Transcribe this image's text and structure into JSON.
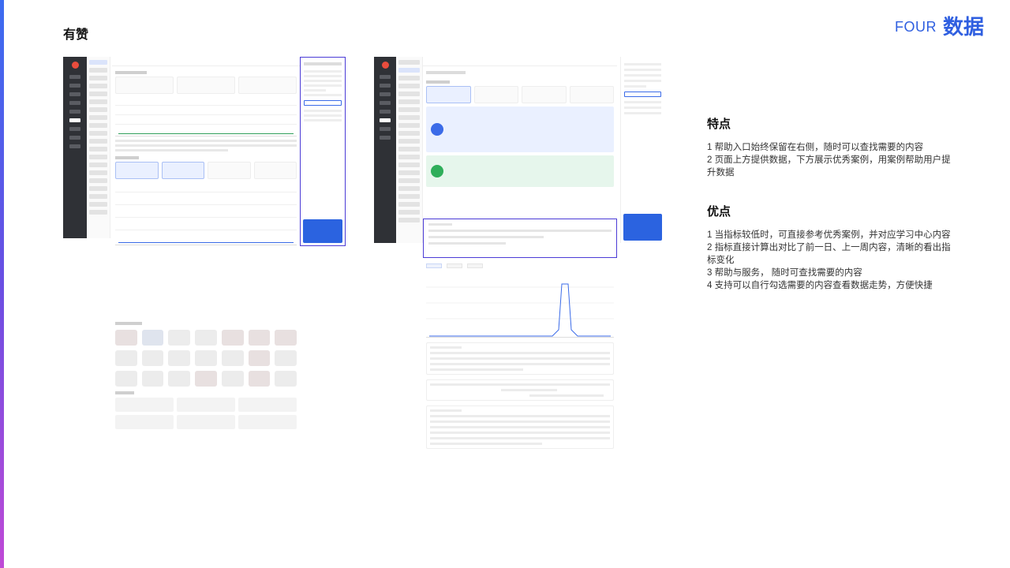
{
  "header": {
    "brand": "有赞",
    "section_no": "FOUR",
    "section_title": "数据"
  },
  "features": {
    "title": "特点",
    "items": [
      "1 帮助入口始终保留在右侧，随时可以查找需要的内容",
      "2 页面上方提供数据，下方展示优秀案例，用案例帮助用户提升数据"
    ]
  },
  "advantages": {
    "title": "优点",
    "items": [
      "1 当指标较低时，可直接参考优秀案例，并对应学习中心内容",
      "2 指标直接计算出对比了前一日、上一周内容，清晰的看出指标变化",
      "3 帮助与服务， 随时可查找需要的内容",
      "4 支持可以自行勾选需要的内容查看数据走势，方便快捷"
    ]
  },
  "colors": {
    "accent": "#2f5fe0",
    "highlight_border": "#4b3bd6"
  }
}
